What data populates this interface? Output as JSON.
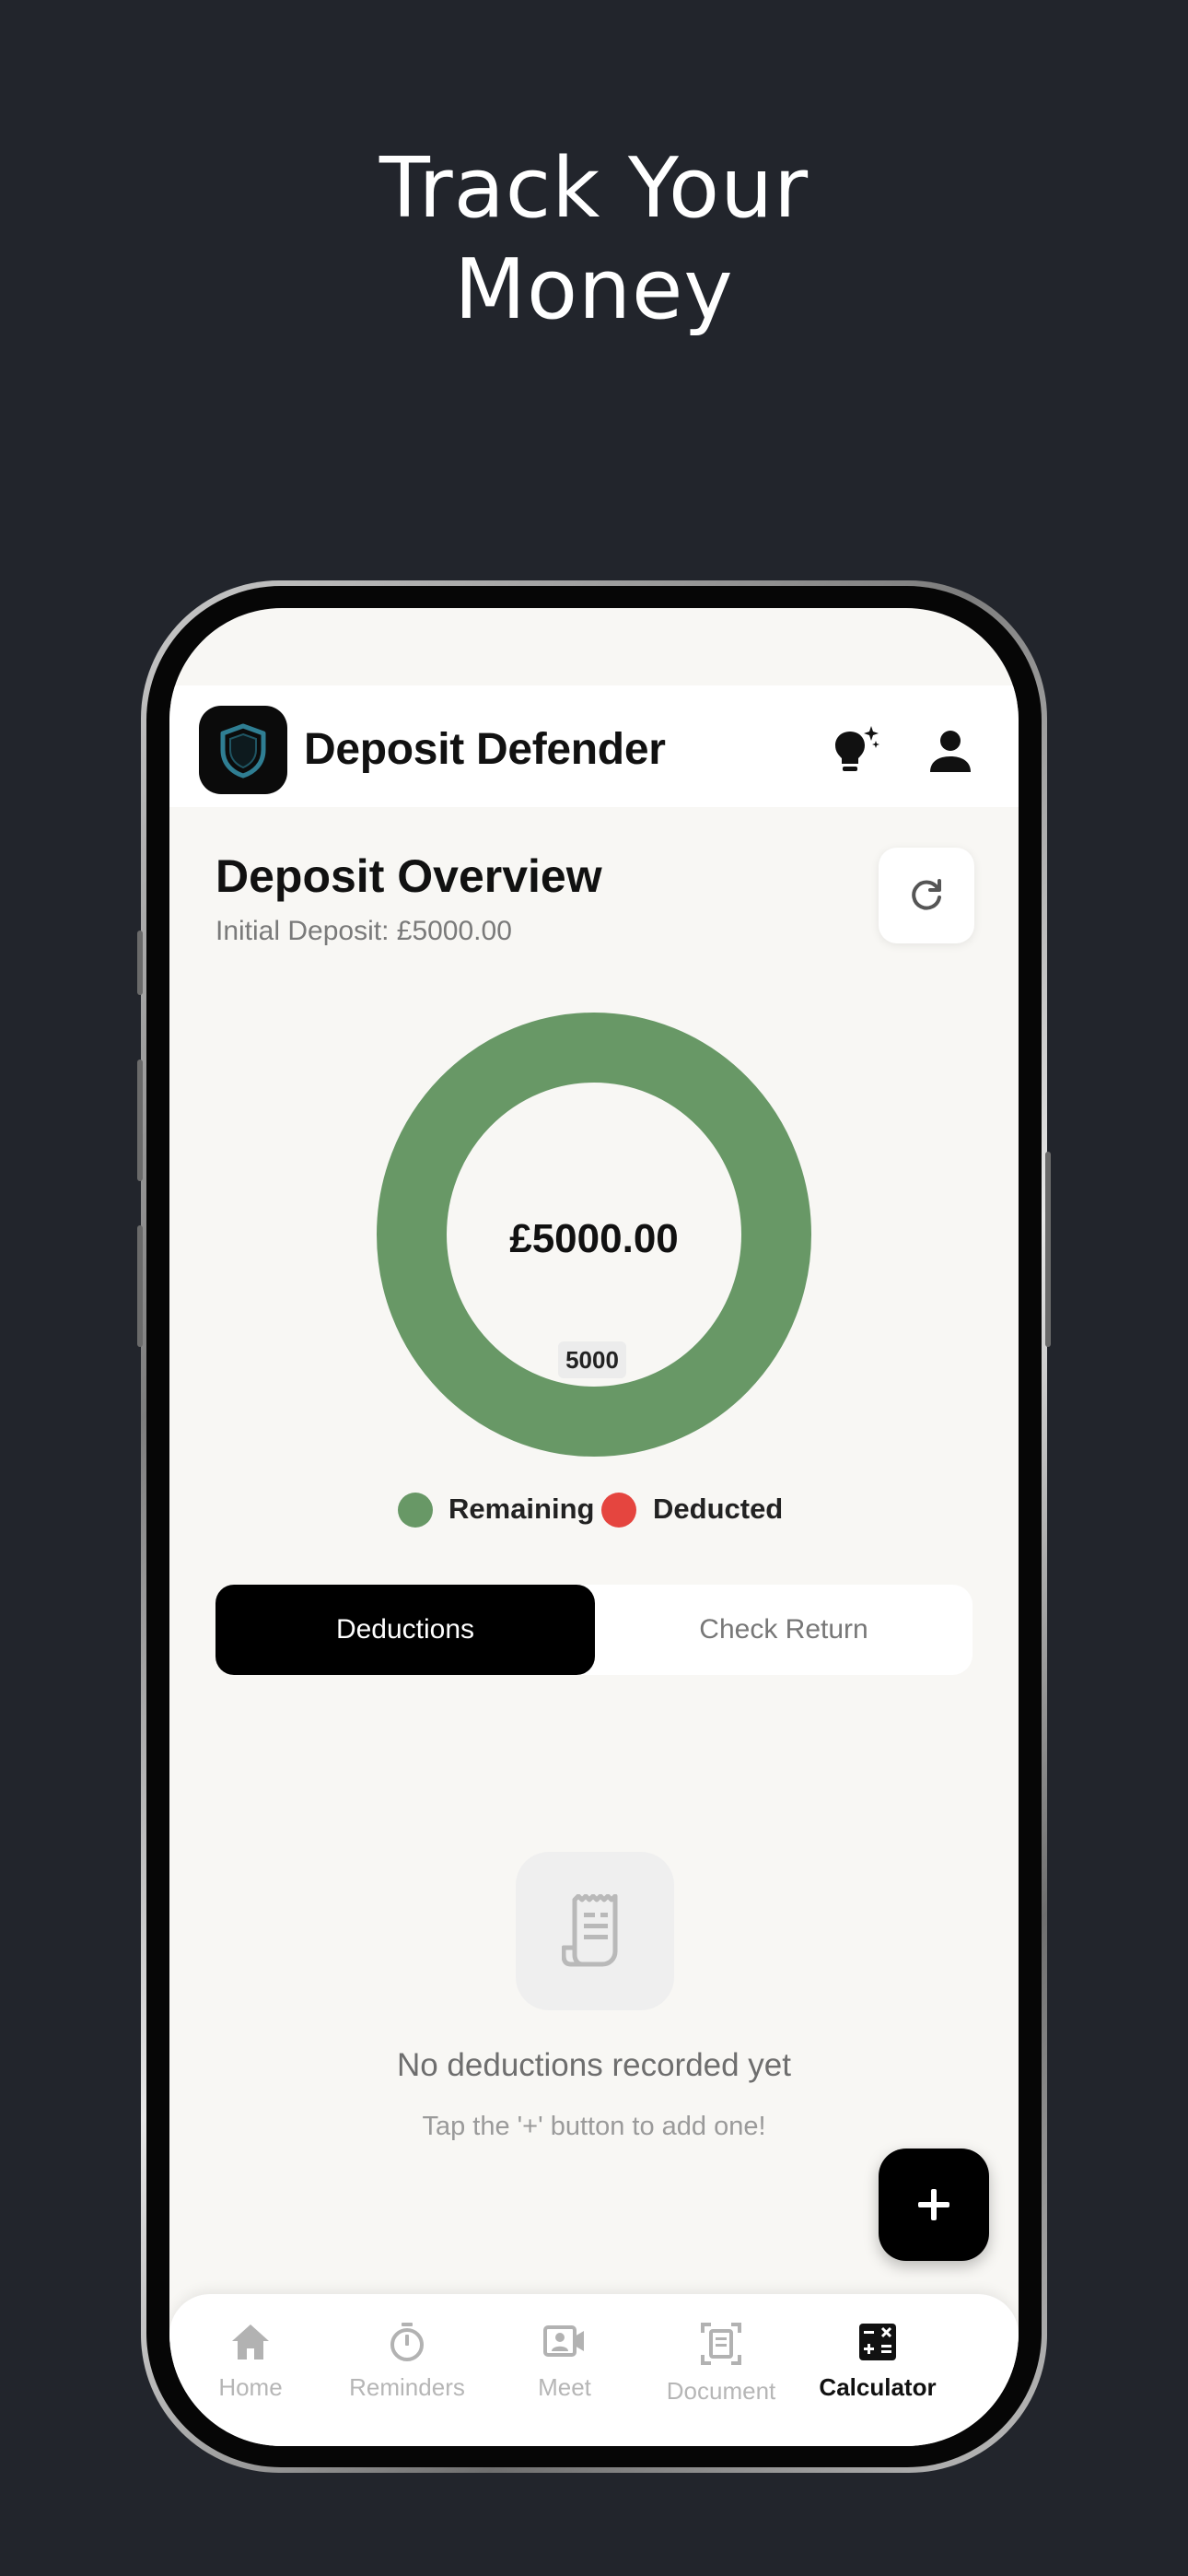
{
  "headline": {
    "line1": "Track Your",
    "line2": "Money"
  },
  "app": {
    "title": "Deposit Defender"
  },
  "overview": {
    "title": "Deposit Overview",
    "initial_deposit": "Initial Deposit: £5000.00"
  },
  "chart_data": {
    "type": "pie",
    "categories": [
      "Remaining",
      "Deducted"
    ],
    "values": [
      5000,
      0
    ],
    "colors": [
      "#689866",
      "#e5453f"
    ],
    "center_label": "£5000.00",
    "data_label": "5000"
  },
  "legend": {
    "remaining": "Remaining",
    "deducted": "Deducted"
  },
  "tabs": {
    "deductions": "Deductions",
    "check_return": "Check Return",
    "selected": "Deductions"
  },
  "empty_state": {
    "title": "No deductions recorded yet",
    "subtitle": "Tap the '+' button to add one!"
  },
  "nav": {
    "items": [
      {
        "label": "Home",
        "icon": "home-icon"
      },
      {
        "label": "Reminders",
        "icon": "stopwatch-icon"
      },
      {
        "label": "Meet",
        "icon": "video-contact-icon"
      },
      {
        "label": "Document",
        "icon": "document-scan-icon"
      },
      {
        "label": "Calculator",
        "icon": "calculator-icon"
      }
    ],
    "active": "Calculator"
  },
  "colors": {
    "background": "#22252c",
    "screen": "#f8f7f4",
    "accent": "#000000",
    "remaining": "#689866",
    "deducted": "#e5453f"
  }
}
